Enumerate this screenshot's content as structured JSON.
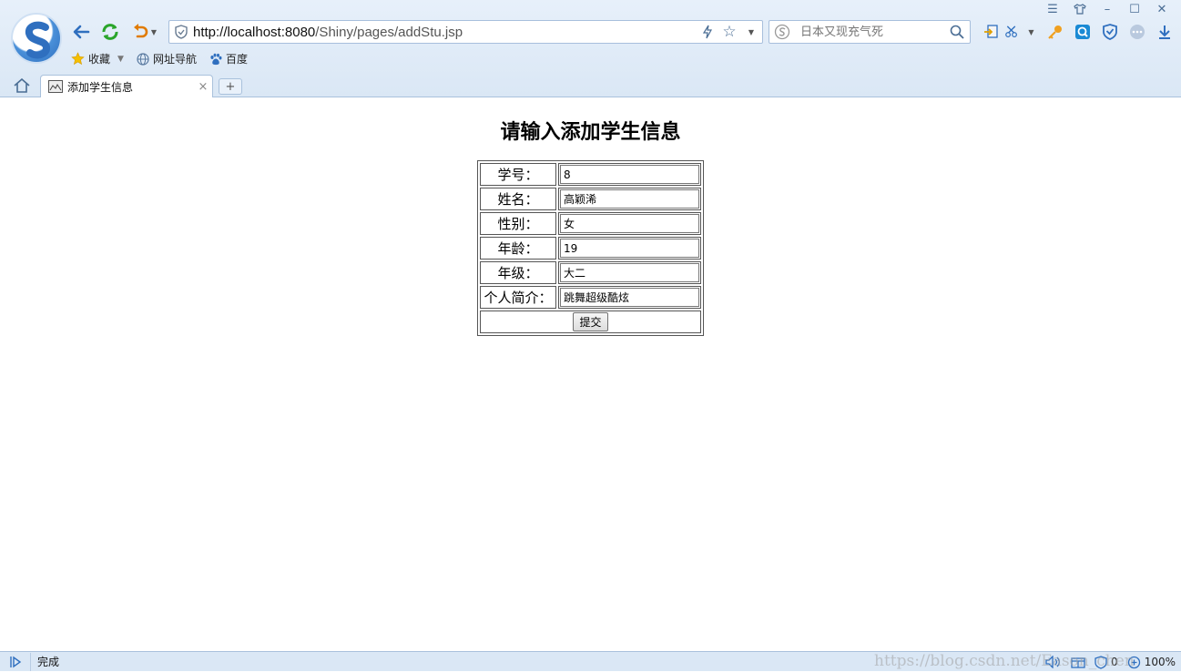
{
  "browser": {
    "address": {
      "host": "http://localhost:8080",
      "path": "/Shiny/pages/addStu.jsp"
    },
    "search": {
      "placeholder": "日本又现充气死"
    },
    "bookmarks": [
      {
        "label": "收藏"
      },
      {
        "label": "网址导航"
      },
      {
        "label": "百度"
      }
    ],
    "tab": {
      "title": "添加学生信息",
      "close": "×"
    },
    "new_tab": "+"
  },
  "page": {
    "title": "请输入添加学生信息",
    "form": {
      "rows": [
        {
          "label": "学号：",
          "value": "8"
        },
        {
          "label": "姓名：",
          "value": "高颖浠"
        },
        {
          "label": "性别：",
          "value": "女"
        },
        {
          "label": "年龄：",
          "value": "19"
        },
        {
          "label": "年级：",
          "value": "大二"
        },
        {
          "label": "个人简介：",
          "value": "跳舞超级酷炫"
        }
      ],
      "submit_label": "提交"
    }
  },
  "statusbar": {
    "status": "完成",
    "watermark": "https://blog.csdn.net/Eason_chen",
    "blocked_count": "0",
    "zoom": "100%"
  },
  "colors": {
    "accent": "#2f6fbf",
    "chrome_bg": "#dae7f5",
    "refresh_green": "#2aa52a",
    "undo_orange": "#e07b00"
  }
}
